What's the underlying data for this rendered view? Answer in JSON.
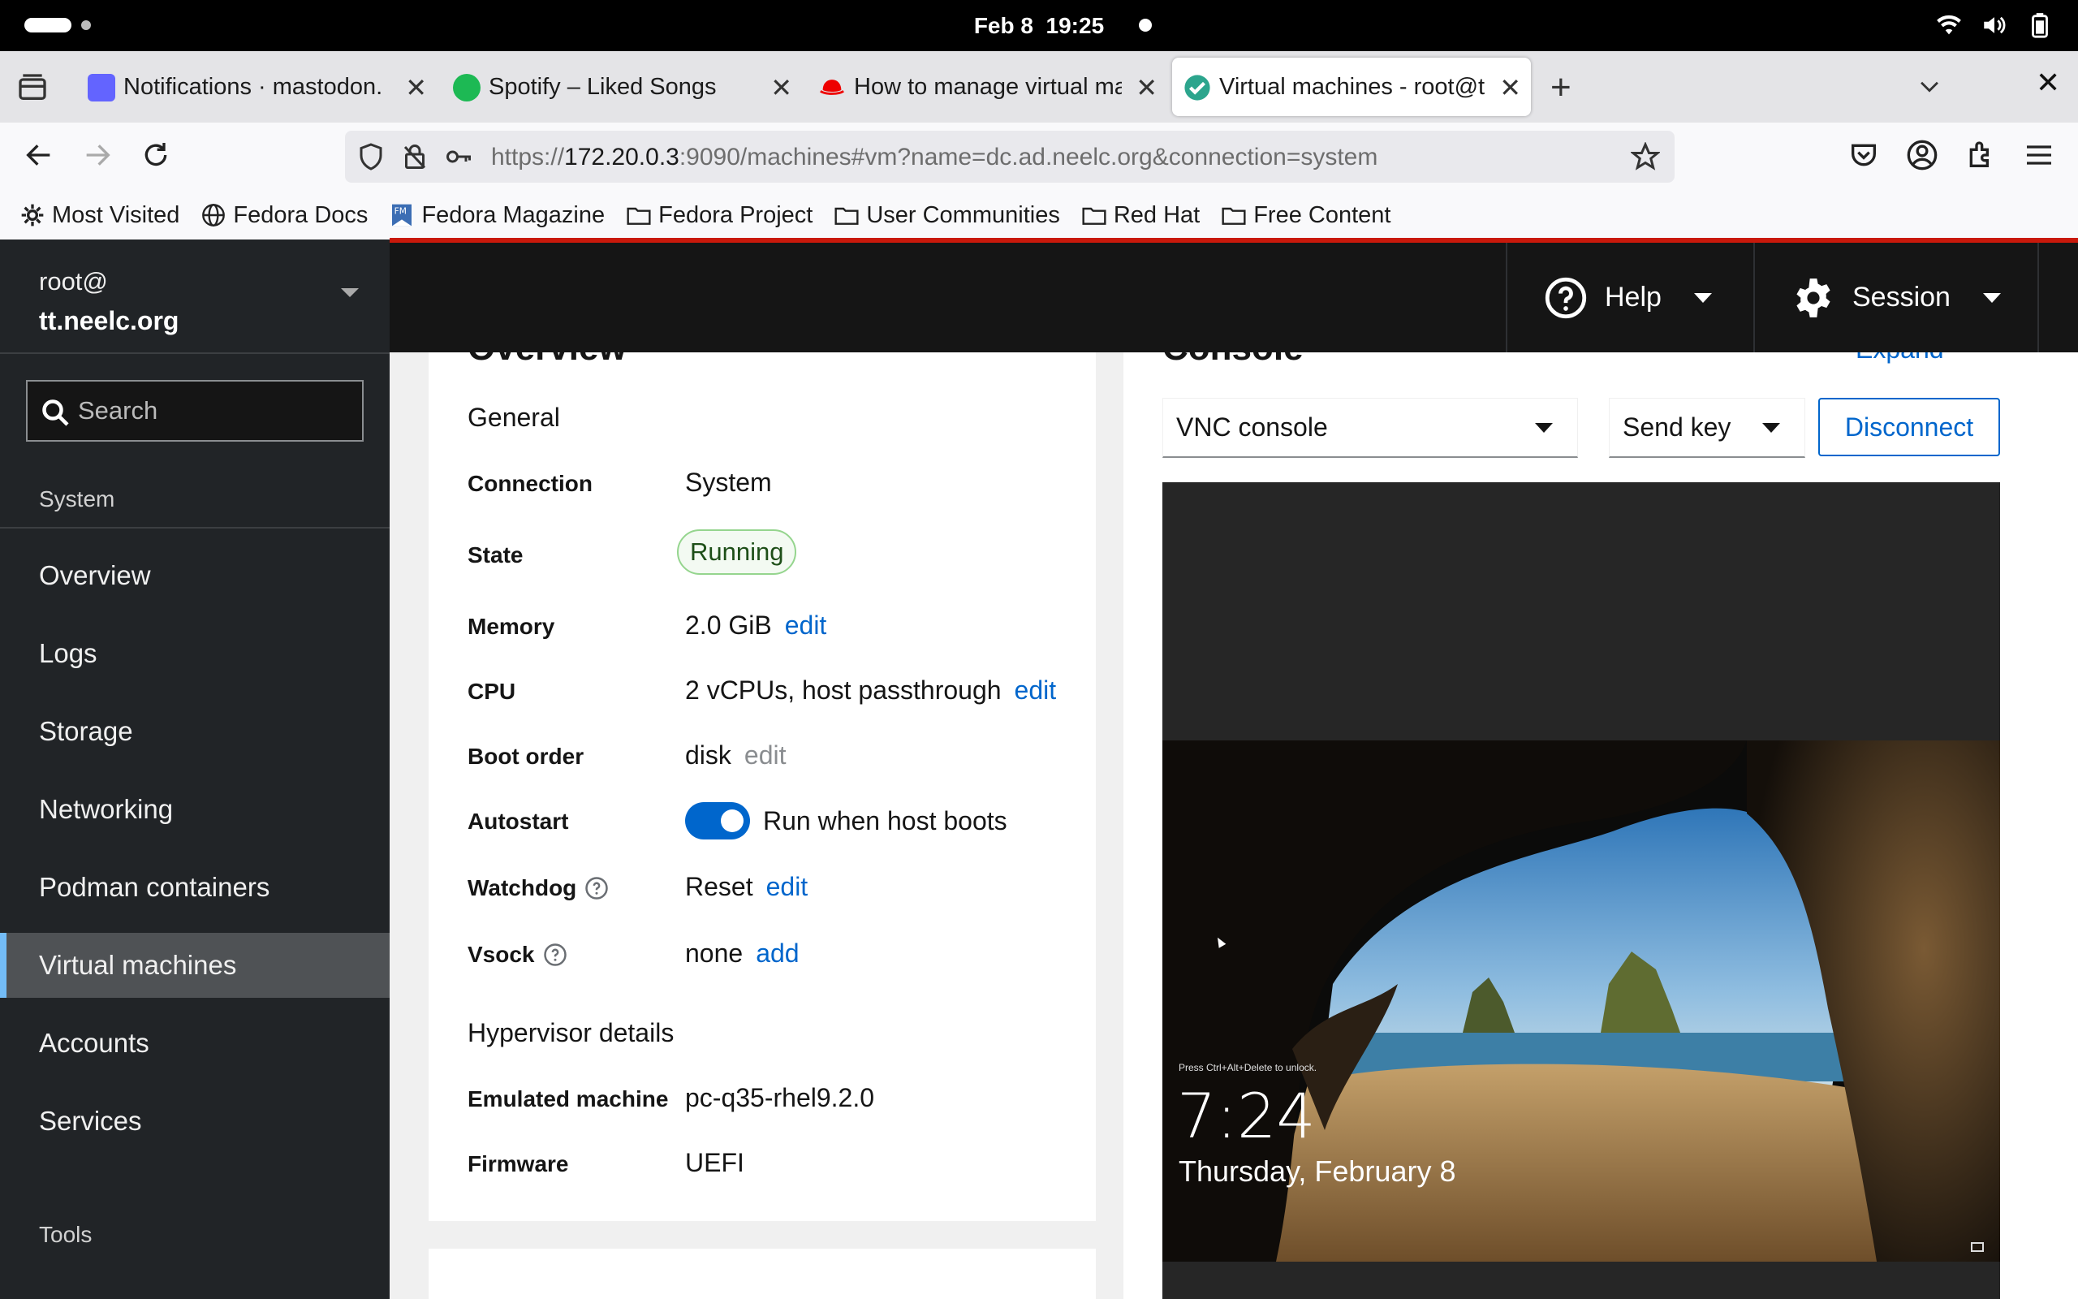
{
  "system_bar": {
    "date": "Feb 8",
    "time": "19:25"
  },
  "browser": {
    "tabs": [
      {
        "title": "Notifications · mastodon.",
        "favicon": "mastodon-icon",
        "color": "#6364ff"
      },
      {
        "title": "Spotify – Liked Songs",
        "favicon": "spotify-icon",
        "color": "#1db954"
      },
      {
        "title": "How to manage virtual ma",
        "favicon": "redhat-icon",
        "color": "#ee0000"
      },
      {
        "title": "Virtual machines - root@t",
        "favicon": "cockpit-icon",
        "color": "#16a085",
        "active": true
      }
    ],
    "url": {
      "scheme": "https://",
      "host": "172.20.0.3",
      "rest": ":9090/machines#vm?name=dc.ad.neelc.org&connection=system"
    },
    "bookmarks": [
      "Most Visited",
      "Fedora Docs",
      "Fedora Magazine",
      "Fedora Project",
      "User Communities",
      "Red Hat",
      "Free Content"
    ]
  },
  "sidebar": {
    "user": "root@",
    "host": "tt.neelc.org",
    "search_placeholder": "Search",
    "section_system": "System",
    "items": [
      "Overview",
      "Logs",
      "Storage",
      "Networking",
      "Podman containers",
      "Virtual machines",
      "Accounts",
      "Services"
    ],
    "active_item": "Virtual machines",
    "section_tools": "Tools"
  },
  "header": {
    "help": "Help",
    "session": "Session"
  },
  "overview": {
    "title": "Overview",
    "general": "General",
    "rows": {
      "connection_label": "Connection",
      "connection_value": "System",
      "state_label": "State",
      "state_value": "Running",
      "memory_label": "Memory",
      "memory_value": "2.0 GiB",
      "memory_action": "edit",
      "cpu_label": "CPU",
      "cpu_value": "2 vCPUs, host passthrough",
      "cpu_action": "edit",
      "boot_label": "Boot order",
      "boot_value": "disk",
      "boot_action": "edit",
      "autostart_label": "Autostart",
      "autostart_value": "Run when host boots",
      "watchdog_label": "Watchdog",
      "watchdog_value": "Reset",
      "watchdog_action": "edit",
      "vsock_label": "Vsock",
      "vsock_value": "none",
      "vsock_action": "add"
    },
    "hypervisor": "Hypervisor details",
    "emulated_label": "Emulated machine",
    "emulated_value": "pc-q35-rhel9.2.0",
    "firmware_label": "Firmware",
    "firmware_value": "UEFI"
  },
  "console": {
    "title": "Console",
    "expand": "Expand",
    "type_select": "VNC console",
    "send_key": "Send key",
    "disconnect": "Disconnect",
    "lock_hint": "Press Ctrl+Alt+Delete to unlock.",
    "lock_time": "7:24",
    "lock_date": "Thursday, February 8"
  },
  "colors": {
    "accent": "#0066cc",
    "sidebar_bg": "#212427",
    "header_bg": "#151515",
    "running_badge": "#95d58e"
  }
}
